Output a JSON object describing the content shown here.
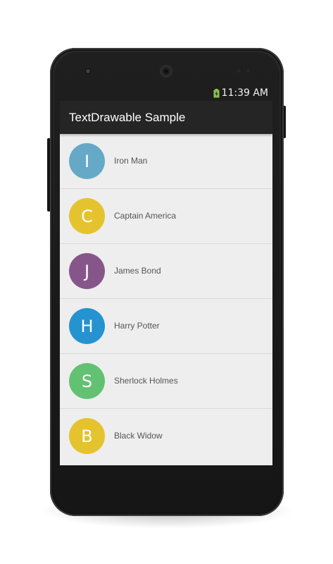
{
  "status_bar": {
    "time": "11:39 AM",
    "battery_icon": "battery-charging-icon"
  },
  "action_bar": {
    "title": "TextDrawable Sample"
  },
  "list": {
    "items": [
      {
        "initial": "I",
        "label": "Iron Man",
        "color": "#66A9C6"
      },
      {
        "initial": "C",
        "label": "Captain America",
        "color": "#E4C32E"
      },
      {
        "initial": "J",
        "label": "James Bond",
        "color": "#86568A"
      },
      {
        "initial": "H",
        "label": "Harry Potter",
        "color": "#2493D0"
      },
      {
        "initial": "S",
        "label": "Sherlock Holmes",
        "color": "#63C174"
      },
      {
        "initial": "B",
        "label": "Black Widow",
        "color": "#E4C32E"
      }
    ]
  }
}
